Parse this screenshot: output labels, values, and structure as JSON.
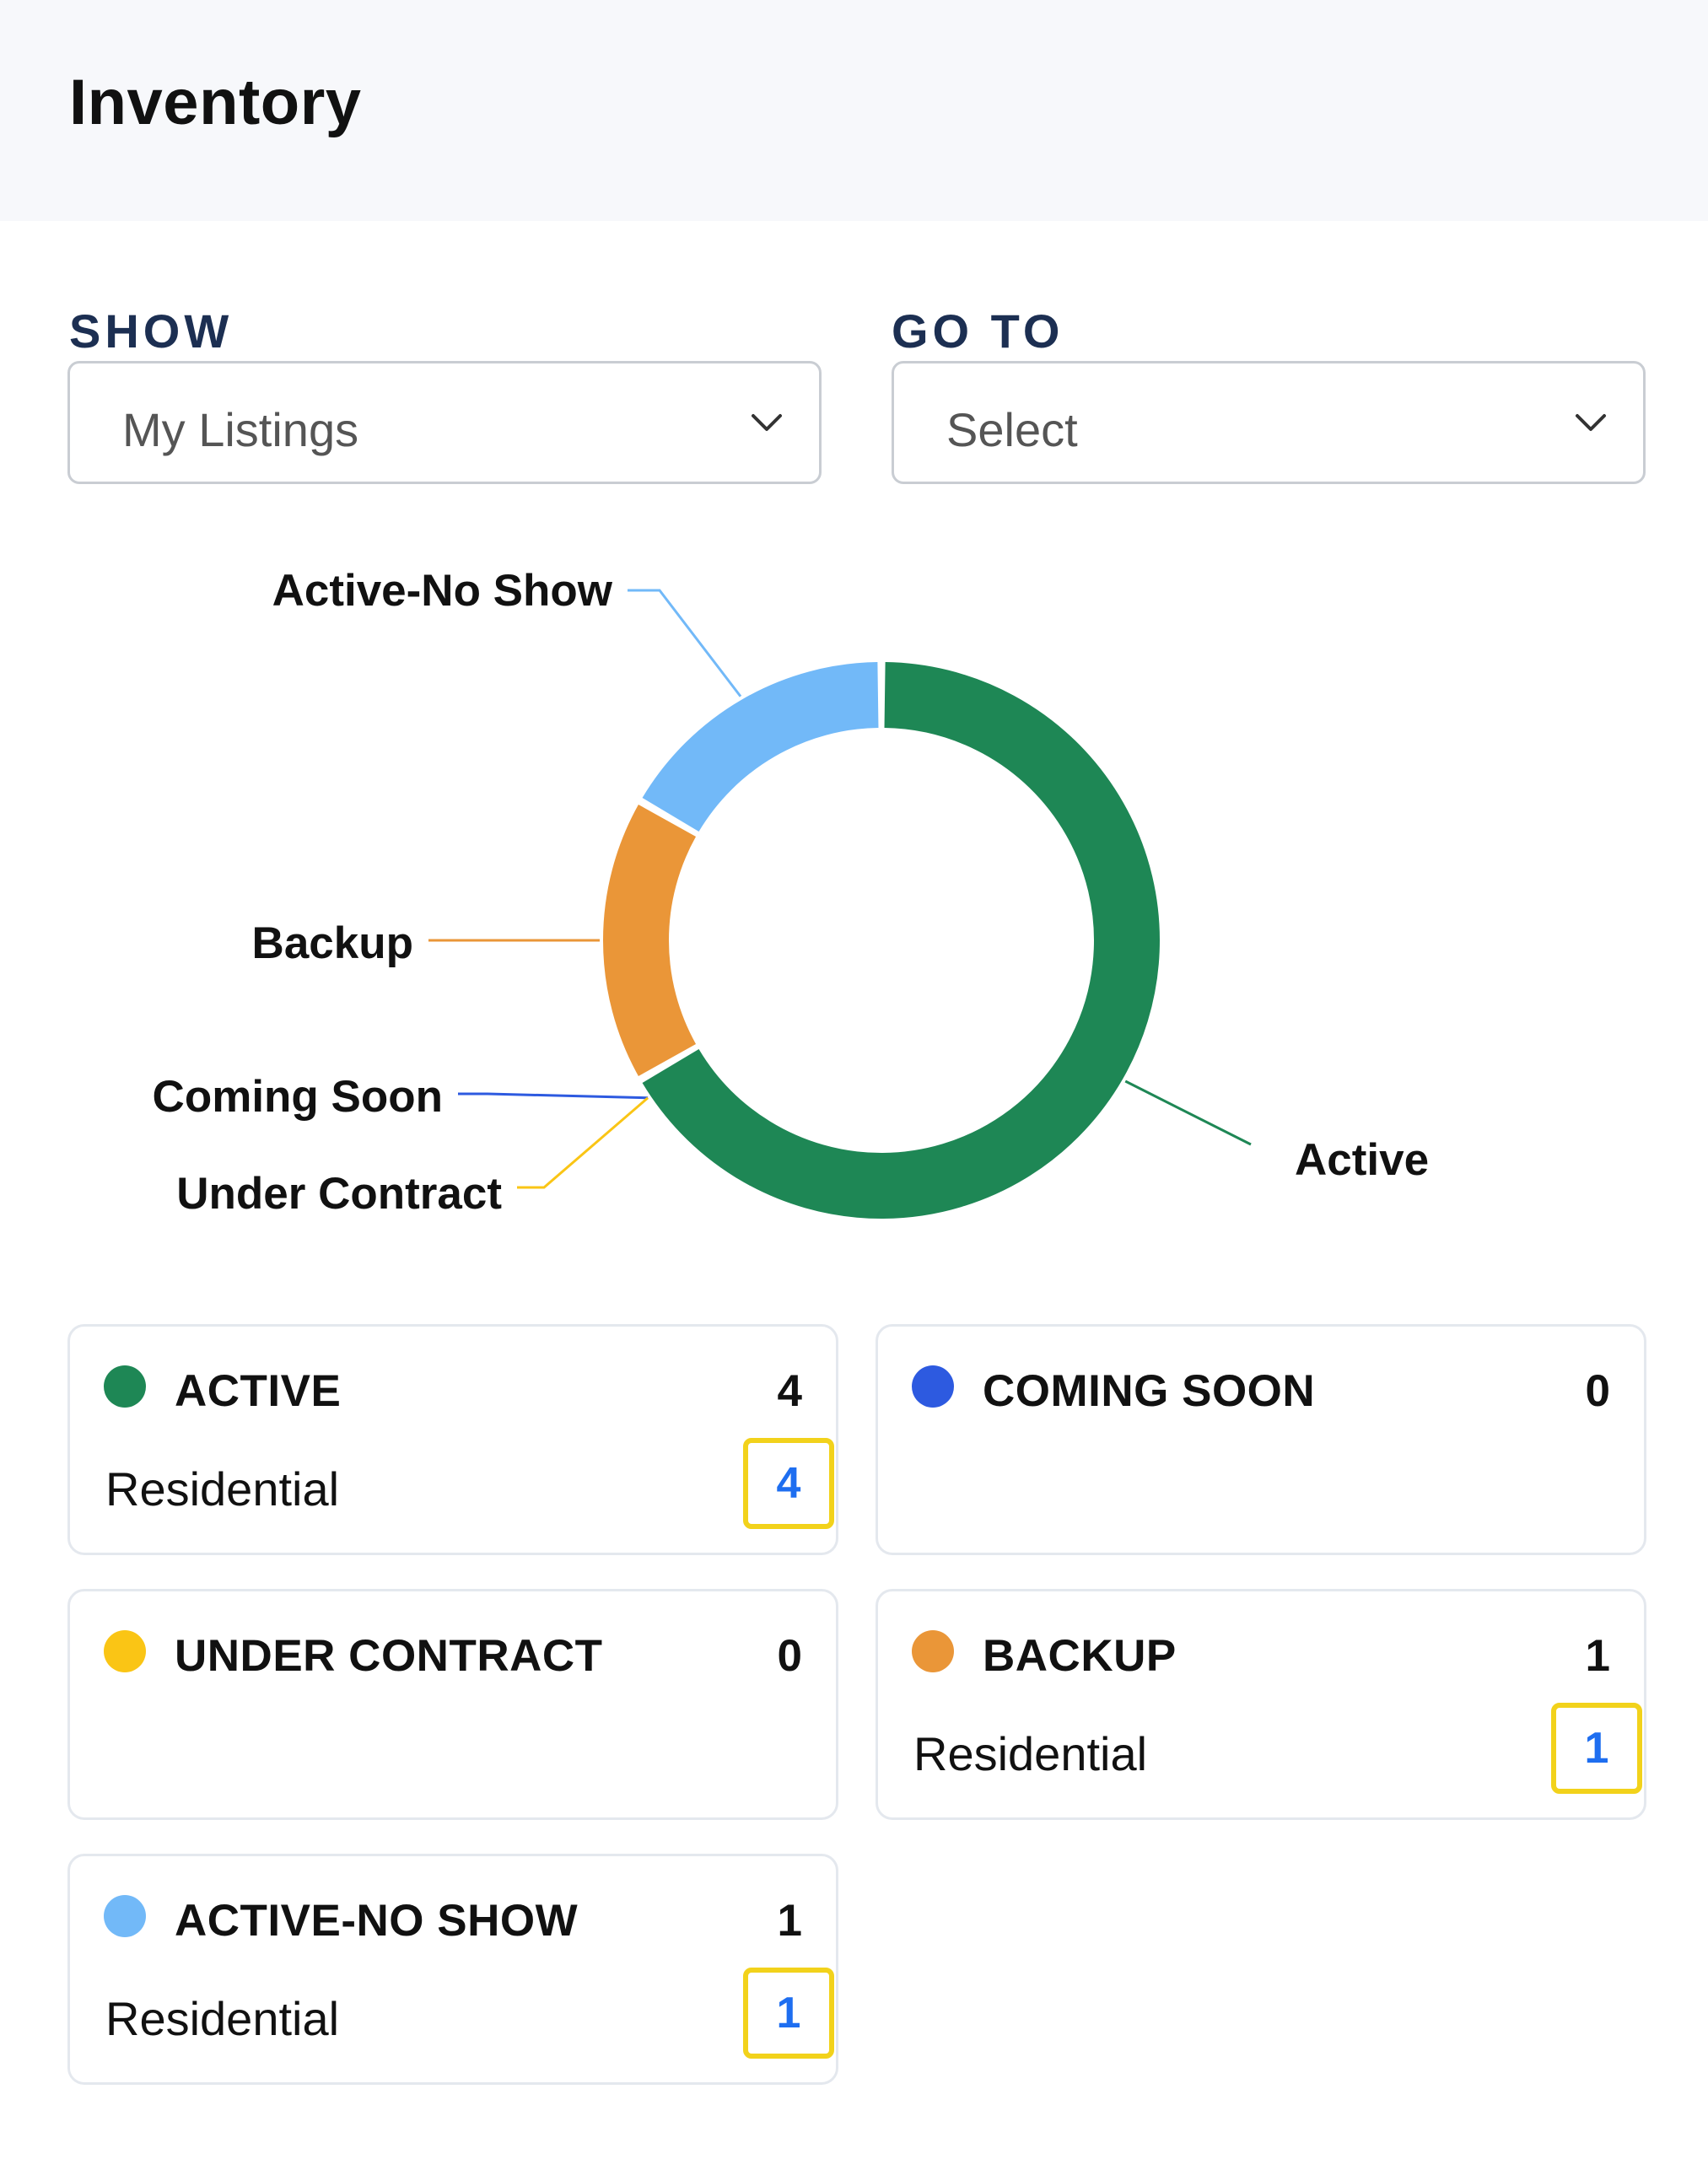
{
  "page": {
    "title": "Inventory"
  },
  "filters": {
    "show": {
      "label": "SHOW",
      "value": "My Listings"
    },
    "goto": {
      "label": "GO TO",
      "value": "Select"
    }
  },
  "colors": {
    "active": "#1e8755",
    "coming_soon": "#2d5ae0",
    "under_contract": "#fac515",
    "backup": "#ea9638",
    "active_no_show": "#72b9f8"
  },
  "chart_data": {
    "type": "pie",
    "style": "donut",
    "categories": [
      "Active",
      "Coming Soon",
      "Under Contract",
      "Backup",
      "Active-No Show"
    ],
    "values": [
      4,
      0,
      0,
      1,
      1
    ]
  },
  "cards": [
    {
      "key": "active",
      "title": "ACTIVE",
      "total": "4",
      "sub_label": "Residential",
      "sub_count": "4"
    },
    {
      "key": "coming_soon",
      "title": "COMING SOON",
      "total": "0"
    },
    {
      "key": "under_contract",
      "title": "UNDER CONTRACT",
      "total": "0"
    },
    {
      "key": "backup",
      "title": "BACKUP",
      "total": "1",
      "sub_label": "Residential",
      "sub_count": "1"
    },
    {
      "key": "active_no_show",
      "title": "ACTIVE-NO SHOW",
      "total": "1",
      "sub_label": "Residential",
      "sub_count": "1"
    }
  ]
}
